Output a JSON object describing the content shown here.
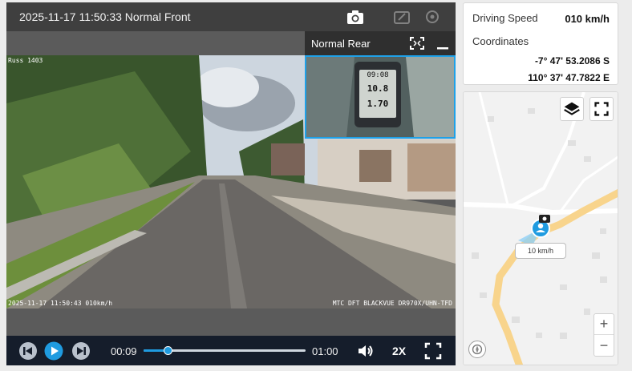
{
  "player": {
    "title": "2025-11-17 11:50:33 Normal Front",
    "icons": {
      "snapshot": "camera-icon",
      "disabled_a": "edit-icon",
      "disabled_b": "settings-icon"
    },
    "osd": {
      "top_left": "Russ 1403",
      "bottom_left": "2025-11-17 11:50:43 010km/h",
      "bottom_right": "MTC DFT BLACKVUE DR970X/UHN-TFD"
    },
    "rear": {
      "label": "Normal Rear",
      "icons": {
        "expand": "expand-icon",
        "minimize": "minimize-icon"
      },
      "dash_readout": {
        "time": "09:08",
        "speed": "10.8",
        "distance": "1.70"
      }
    },
    "controls": {
      "current_time": "00:09",
      "total_time": "01:00",
      "progress": 0.15,
      "playback_rate": "2X",
      "icons": {
        "previous": "skip-back-icon",
        "play": "play-icon",
        "next": "skip-forward-icon",
        "volume": "volume-icon",
        "fullscreen": "fullscreen-icon"
      }
    }
  },
  "info": {
    "speed_label": "Driving Speed",
    "speed_value": "010 km/h",
    "coordinates_label": "Coordinates",
    "latitude": "-7° 47' 53.2086 S",
    "longitude": "110° 37' 47.7822 E"
  },
  "map": {
    "marker_label": "10 km/h",
    "zoom_in": "+",
    "zoom_out": "−",
    "icons": {
      "layers": "layers-icon",
      "fullscreen": "fullscreen-icon",
      "marker": "vehicle-marker-icon",
      "compass": "compass-icon"
    },
    "colors": {
      "road": "#f8d48c",
      "marker": "#1f9be0",
      "accent": "#1f9be0"
    }
  }
}
